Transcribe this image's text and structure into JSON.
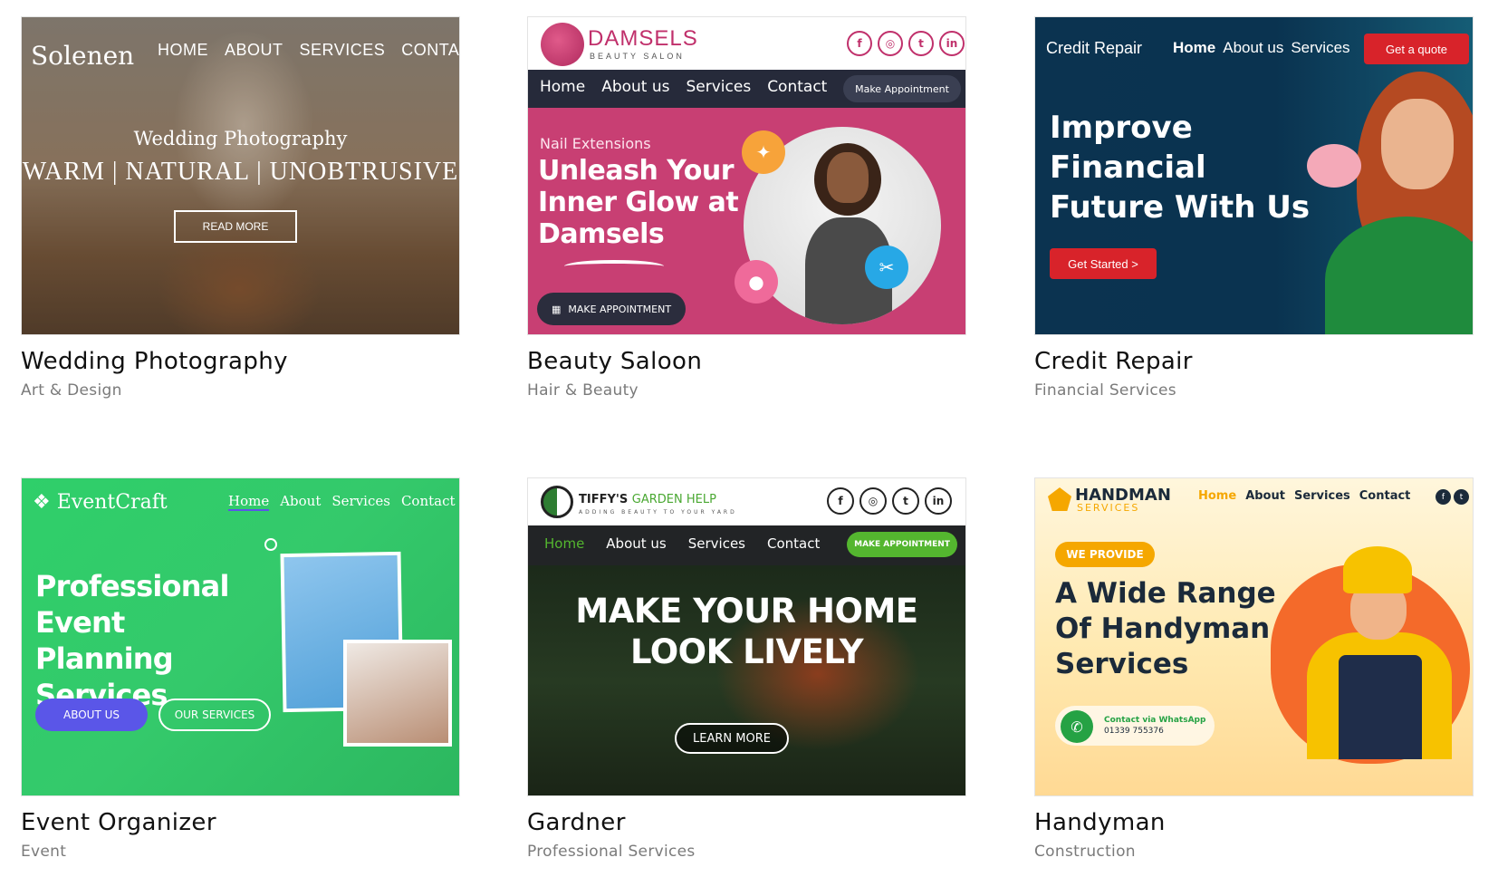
{
  "cards": [
    {
      "title": "Wedding Photography",
      "category": "Art & Design",
      "thumb": {
        "logo": "Solenen",
        "nav": [
          "HOME",
          "ABOUT",
          "SERVICES",
          "CONTACT"
        ],
        "kicker": "Wedding Photography",
        "headline": "WARM | NATURAL | UNOBTRUSIVE",
        "button": "READ MORE"
      }
    },
    {
      "title": "Beauty Saloon",
      "category": "Hair & Beauty",
      "thumb": {
        "logo": "DAMSELS",
        "logo_sub": "BEAUTY SALON",
        "social": [
          "facebook-icon",
          "instagram-icon",
          "twitter-icon",
          "linkedin-icon"
        ],
        "nav": [
          "Home",
          "About us",
          "Services",
          "Contact"
        ],
        "nav_button": "Make Appointment",
        "kicker": "Nail Extensions",
        "headline": "Unleash Your Inner Glow at Damsels",
        "button": "MAKE APPOINTMENT"
      }
    },
    {
      "title": "Credit Repair",
      "category": "Financial Services",
      "thumb": {
        "brand": "Credit Repair",
        "nav": [
          "Home",
          "About us",
          "Services"
        ],
        "nav_button": "Get a quote",
        "headline": "Improve Financial Future With Us",
        "button": "Get Started  >"
      }
    },
    {
      "title": "Event Organizer",
      "category": "Event",
      "thumb": {
        "logo": "EventCraft",
        "nav": [
          "Home",
          "About",
          "Services",
          "Contact"
        ],
        "headline": "Professional Event Planning Services",
        "button_primary": "ABOUT US",
        "button_secondary": "OUR SERVICES"
      }
    },
    {
      "title": "Gardner",
      "category": "Professional Services",
      "thumb": {
        "logo": "TIFFY'S",
        "logo_accent": "GARDEN HELP",
        "logo_sub": "ADDING BEAUTY TO YOUR YARD",
        "social": [
          "facebook-icon",
          "instagram-icon",
          "twitter-icon",
          "linkedin-icon"
        ],
        "nav": [
          "Home",
          "About us",
          "Services",
          "Contact"
        ],
        "nav_button": "MAKE APPOINTMENT",
        "headline": "MAKE YOUR HOME LOOK LIVELY",
        "button": "LEARN MORE"
      }
    },
    {
      "title": "Handyman",
      "category": "Construction",
      "thumb": {
        "logo": "HANDMAN",
        "logo_sub": "SERVICES",
        "nav": [
          "Home",
          "About",
          "Services",
          "Contact"
        ],
        "badge": "WE PROVIDE",
        "headline": "A Wide Range Of Handyman Services",
        "contact_label": "Contact via WhatsApp",
        "contact_number": "01339 755376"
      }
    }
  ],
  "colors": {
    "title": "#111111",
    "category": "#7a7a7a",
    "beauty_accent": "#c83f73",
    "credit_bg": "#0b3350",
    "credit_accent": "#d8232a",
    "event_bg": "#34c96b",
    "garden_accent": "#54b62f",
    "handyman_accent": "#f5a700"
  }
}
